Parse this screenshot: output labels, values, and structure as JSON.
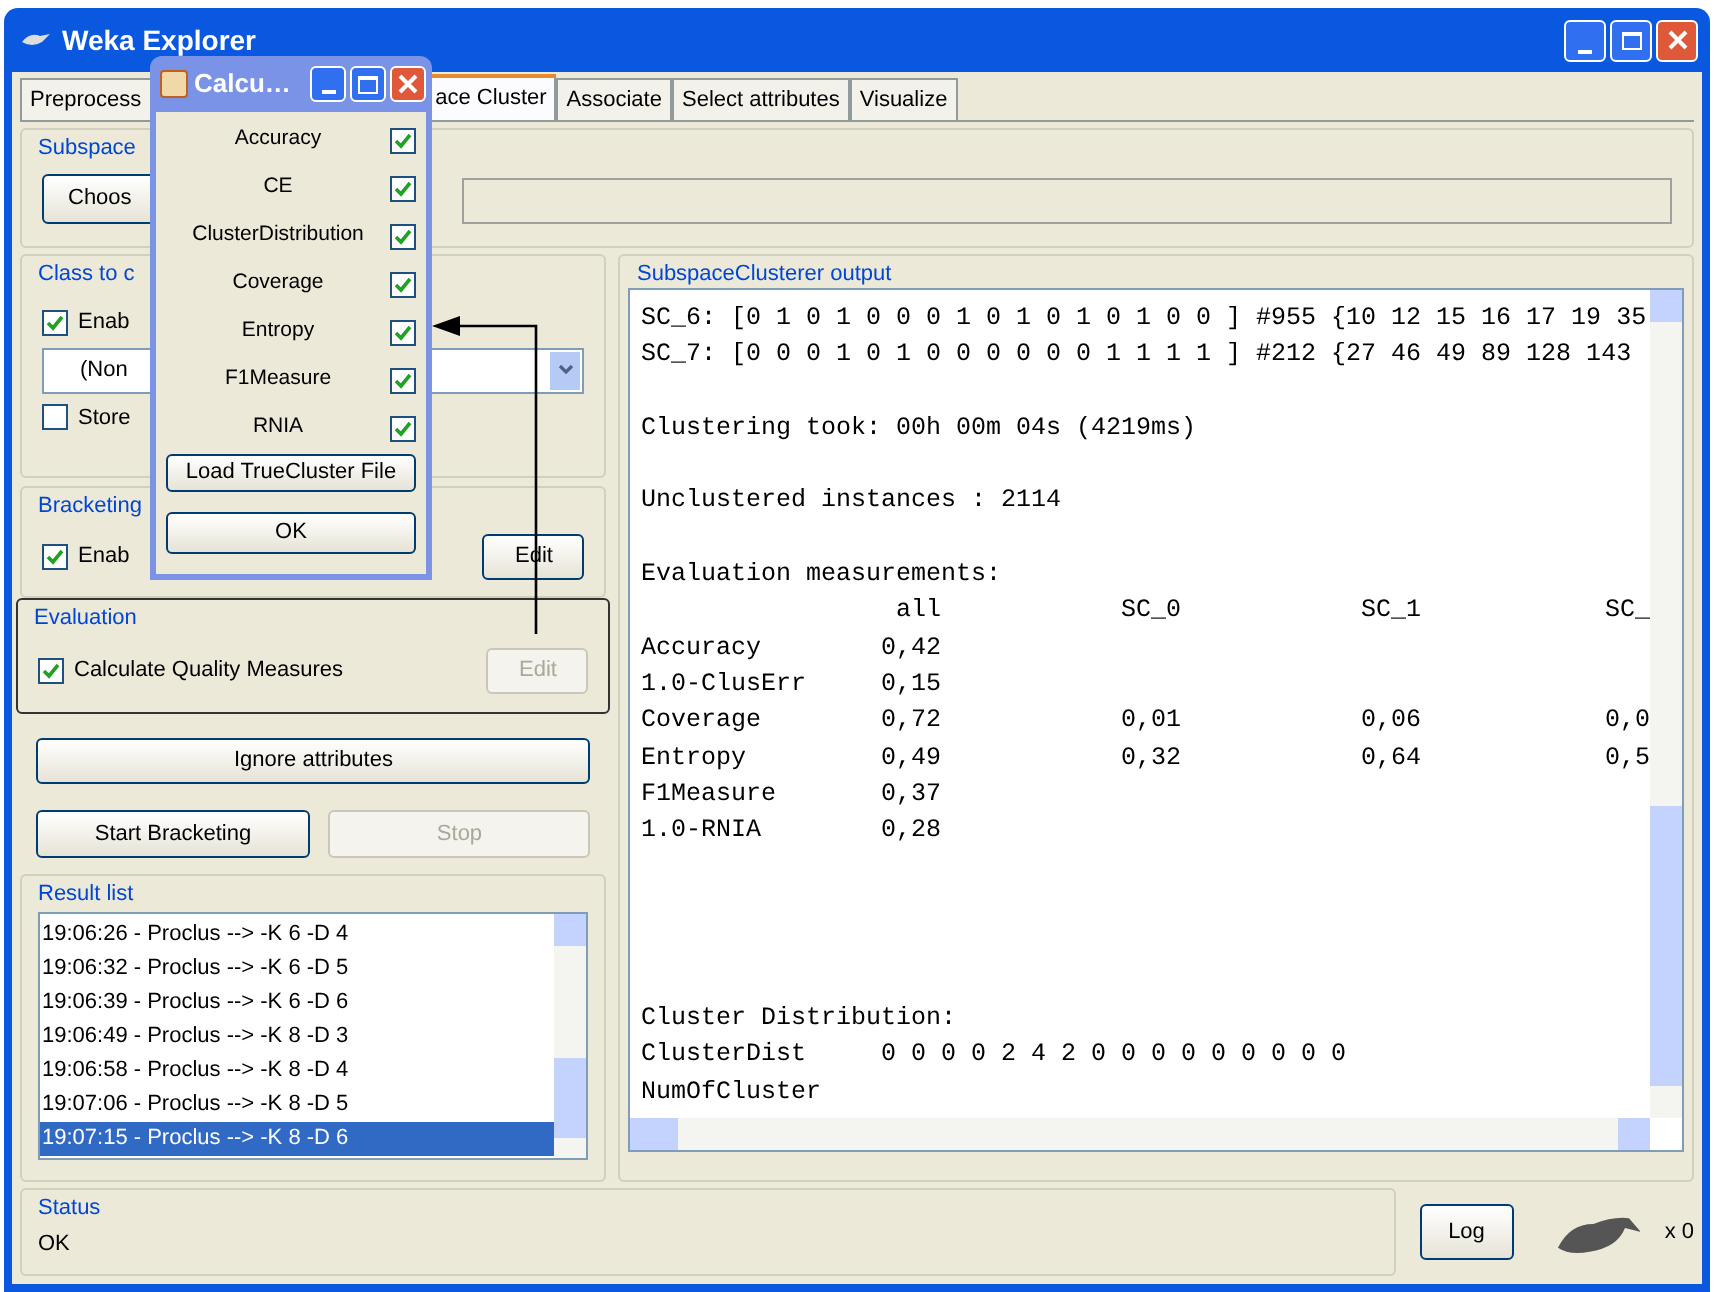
{
  "window": {
    "title": "Weka Explorer"
  },
  "tabs": [
    {
      "label": "Preprocess",
      "selected": false
    },
    {
      "label": "ace Cluster",
      "selected": true
    },
    {
      "label": "Associate",
      "selected": false
    },
    {
      "label": "Select attributes",
      "selected": false
    },
    {
      "label": "Visualize",
      "selected": false
    }
  ],
  "subspace_clusterer": {
    "title": "Subspace",
    "button": "Choos"
  },
  "class_to_cluster": {
    "title": "Class to c",
    "enable": {
      "label": "Enab",
      "checked": true
    },
    "combo": {
      "value": "(Non"
    },
    "store": {
      "label": "Store",
      "checked": false
    }
  },
  "bracketing": {
    "title": "Bracketing",
    "enable": {
      "label": "Enab",
      "checked": true
    },
    "edit": {
      "label": "Edit",
      "disabled": false
    }
  },
  "evaluation": {
    "title": "Evaluation",
    "calculate": {
      "label": "Calculate Quality Measures",
      "checked": true
    },
    "edit": {
      "label": "Edit",
      "disabled": true
    }
  },
  "ignore_button": "Ignore attributes",
  "start_button": {
    "label": "Start Bracketing",
    "disabled": false
  },
  "stop_button": {
    "label": "Stop",
    "disabled": true
  },
  "result_list": {
    "title": "Result list",
    "items": [
      {
        "label": "19:06:26 - Proclus --> -K 6 -D 4",
        "selected": false
      },
      {
        "label": "19:06:32 - Proclus --> -K 6 -D 5",
        "selected": false
      },
      {
        "label": "19:06:39 - Proclus --> -K 6 -D 6",
        "selected": false
      },
      {
        "label": "19:06:49 - Proclus --> -K 8 -D 3",
        "selected": false
      },
      {
        "label": "19:06:58 - Proclus --> -K 8 -D 4",
        "selected": false
      },
      {
        "label": "19:07:06 - Proclus --> -K 8 -D 5",
        "selected": false
      },
      {
        "label": "19:07:15 - Proclus --> -K 8 -D 6",
        "selected": true
      }
    ]
  },
  "output": {
    "title": "SubspaceClusterer output",
    "blocks": [
      {
        "lines": [
          "SC_6: [0 1 0 1 0 0 0 1 0 1 0 1 0 1 0 0 ] #955 {10 12 15 16 17 19 35",
          "SC_7: [0 0 0 1 0 1 0 0 0 0 0 0 1 1 1 1 ] #212 {27 46 49 89 128 143"
        ]
      },
      {
        "lines": [
          "Clustering took: 00h 00m 04s (4219ms)"
        ]
      },
      {
        "lines": [
          "Unclustered instances : 2114"
        ]
      },
      {
        "lines": [
          "Evaluation measurements:"
        ]
      }
    ],
    "table": {
      "columns": [
        "all",
        "SC_0",
        "SC_1",
        "SC_"
      ],
      "rows": [
        {
          "label": "Accuracy",
          "values": [
            "0,42"
          ]
        },
        {
          "label": "1.0-ClusErr",
          "values": [
            "0,15"
          ]
        },
        {
          "label": "Coverage",
          "values": [
            "0,72",
            "0,01",
            "0,06",
            "0,0"
          ]
        },
        {
          "label": "Entropy",
          "values": [
            "0,49",
            "0,32",
            "0,64",
            "0,5"
          ]
        },
        {
          "label": "F1Measure",
          "values": [
            "0,37"
          ]
        },
        {
          "label": "1.0-RNIA",
          "values": [
            "0,28"
          ]
        }
      ]
    },
    "bottom_lines": [
      "Cluster Distribution:",
      "ClusterDist     0 0 0 0 2 4 2 0 0 0 0 0 0 0 0 0",
      "NumOfCluster"
    ]
  },
  "status": {
    "title": "Status",
    "text": "OK",
    "log_button": "Log",
    "count": "x 0"
  },
  "dialog": {
    "title": "Calcu…",
    "measures": [
      {
        "label": "Accuracy",
        "checked": true
      },
      {
        "label": "CE",
        "checked": true
      },
      {
        "label": "ClusterDistribution",
        "checked": true
      },
      {
        "label": "Coverage",
        "checked": true
      },
      {
        "label": "Entropy",
        "checked": true
      },
      {
        "label": "F1Measure",
        "checked": true
      },
      {
        "label": "RNIA",
        "checked": true
      }
    ],
    "load_button": "Load TrueCluster File",
    "ok_button": "OK"
  }
}
